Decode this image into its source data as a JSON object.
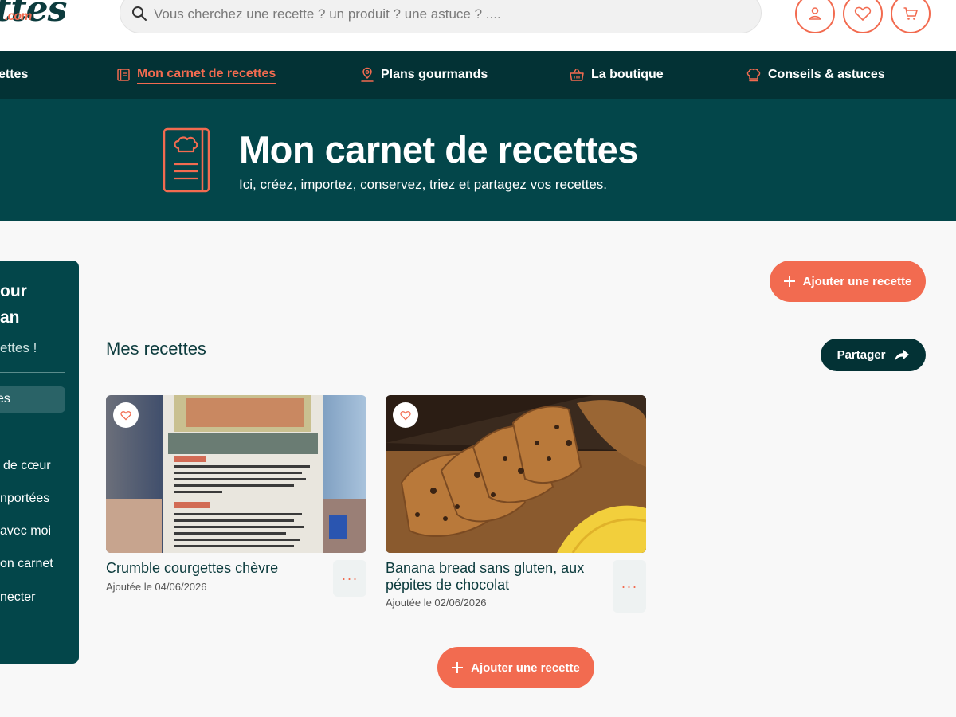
{
  "header": {
    "logo_text": "ttes",
    "logo_suffix": ".com",
    "search_placeholder": "Vous cherchez une recette ? un produit ? une astuce ? ....",
    "icons": [
      "user-icon",
      "heart-icon",
      "cart-icon"
    ]
  },
  "nav": {
    "items": [
      {
        "label": "ettes",
        "icon": "none"
      },
      {
        "label": "Mon carnet de recettes",
        "icon": "notebook-icon",
        "active": true
      },
      {
        "label": "Plans gourmands",
        "icon": "map-pin-icon"
      },
      {
        "label": "La boutique",
        "icon": "basket-icon"
      },
      {
        "label": "Conseils & astuces",
        "icon": "chef-hat-icon"
      }
    ]
  },
  "hero": {
    "title": "Mon carnet de recettes",
    "subtitle": "Ici, créez, importez, conservez, triez et partagez vos recettes.",
    "icon": "recipe-book-icon"
  },
  "sidebar": {
    "title_line1": "our",
    "title_line2": "an",
    "subtitle": "ettes !",
    "active_item": "es",
    "items": [
      "de cœur",
      "nportées",
      "avec moi",
      "on carnet",
      "necter"
    ]
  },
  "main": {
    "add_button_label": "Ajouter une recette",
    "section_title": "Mes recettes",
    "share_button_label": "Partager",
    "recipes": [
      {
        "title": "Crumble courgettes chèvre",
        "date": "Ajoutée le 04/06/2026",
        "image": "recipe-label-photo"
      },
      {
        "title": "Banana bread sans gluten, aux pépites de chocolat",
        "date": "Ajoutée le 02/06/2026",
        "image": "banana-bread-photo"
      }
    ],
    "more_label": "···",
    "bottom_add_button_label": "Ajouter une recette"
  },
  "colors": {
    "brand_dark": "#033235",
    "brand_teal": "#03464a",
    "accent": "#f26b50"
  }
}
